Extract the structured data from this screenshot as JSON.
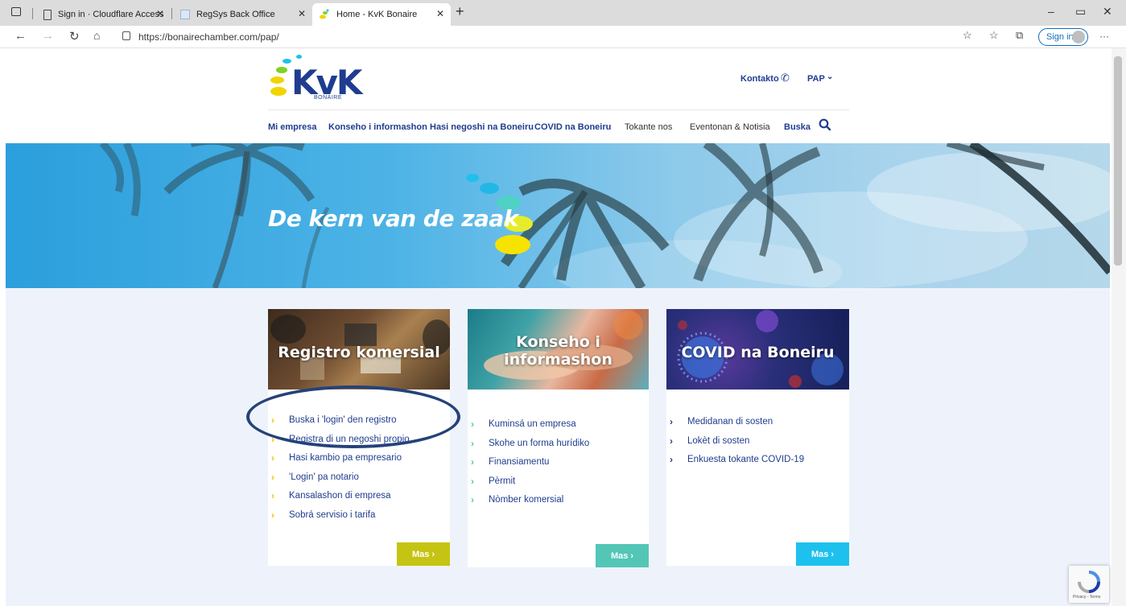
{
  "browser": {
    "tabs": [
      {
        "title": "Sign in · Cloudflare Access"
      },
      {
        "title": "RegSys Back Office"
      },
      {
        "title": "Home - KvK Bonaire"
      }
    ],
    "new_tab_symbol": "+",
    "url": "https://bonairechamber.com/pap/",
    "signin_label": "Sign in",
    "more_symbol": "···"
  },
  "header": {
    "logo_text": "KvK",
    "logo_sub": "BONAIRE",
    "contact_label": "Kontakto",
    "language_label": "PAP",
    "nav": [
      {
        "label": "Mi empresa"
      },
      {
        "label": "Konseho i informashon"
      },
      {
        "label": "Hasi negoshi na Boneiru"
      },
      {
        "label": "COVID na Boneiru"
      },
      {
        "label": "Tokante nos"
      },
      {
        "label": "Eventonan & Notisia"
      },
      {
        "label": "Buska"
      }
    ]
  },
  "hero": {
    "title": "De kern van de zaak"
  },
  "cards": [
    {
      "title": "Registro komersial",
      "items": [
        "Buska i 'login' den registro",
        "Registra di un negoshi propio",
        "Hasi kambio pa empresario",
        "'Login' pa notario",
        "Kansalashon di empresa",
        "Sobrá servisio i tarifa"
      ],
      "button": "Mas  ›",
      "accent": "#c6c412"
    },
    {
      "title": "Konseho i informashon",
      "title_line1": "Konseho i",
      "title_line2": "informashon",
      "items": [
        "Kuminsá un empresa",
        "Skohe un forma hurídiko",
        "Finansiamentu",
        "Pèrmit",
        "Nòmber komersial"
      ],
      "button": "Mas  ›",
      "accent": "#53c6b6"
    },
    {
      "title": "COVID na Boneiru",
      "items": [
        "Medidanan di sosten",
        "Lokèt di sosten",
        "Enkuesta tokante COVID-19"
      ],
      "button": "Mas  ›",
      "accent": "#1ec1ee"
    }
  ],
  "recaptcha": {
    "label": "Privacy - Terms"
  },
  "colors": {
    "brand_blue": "#1f3d8f",
    "chevron_yellow": "#e8c400",
    "chevron_blue": "#1f3d8f"
  }
}
